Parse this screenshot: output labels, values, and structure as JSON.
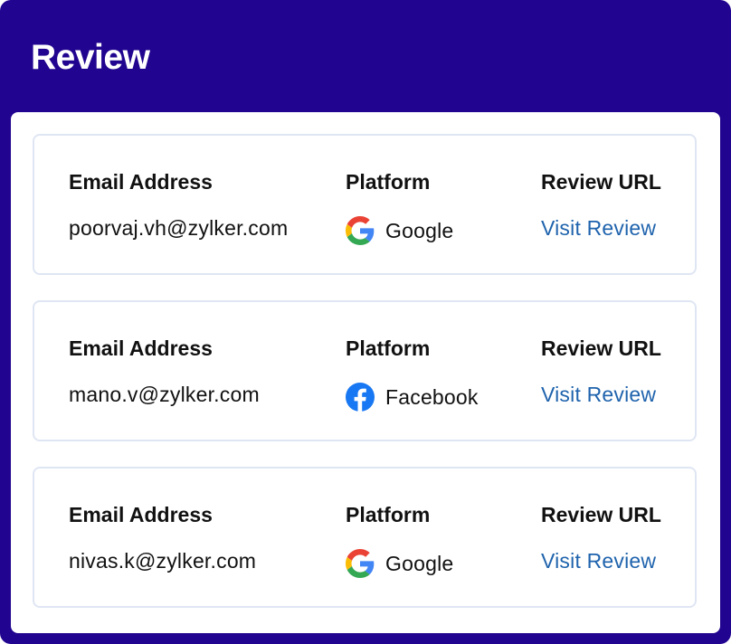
{
  "header": {
    "title": "Review"
  },
  "columns": {
    "email": "Email Address",
    "platform": "Platform",
    "url": "Review URL"
  },
  "reviews": [
    {
      "email": "poorvaj.vh@zylker.com",
      "platform": "Google",
      "platform_icon": "google-icon",
      "link_label": "Visit Review"
    },
    {
      "email": "mano.v@zylker.com",
      "platform": "Facebook",
      "platform_icon": "facebook-icon",
      "link_label": "Visit Review"
    },
    {
      "email": "nivas.k@zylker.com",
      "platform": "Google",
      "platform_icon": "google-icon",
      "link_label": "Visit Review"
    }
  ],
  "colors": {
    "header_bg": "#21048f",
    "link": "#1f63ad",
    "card_border": "#dfe6f3",
    "facebook": "#1877f2"
  }
}
